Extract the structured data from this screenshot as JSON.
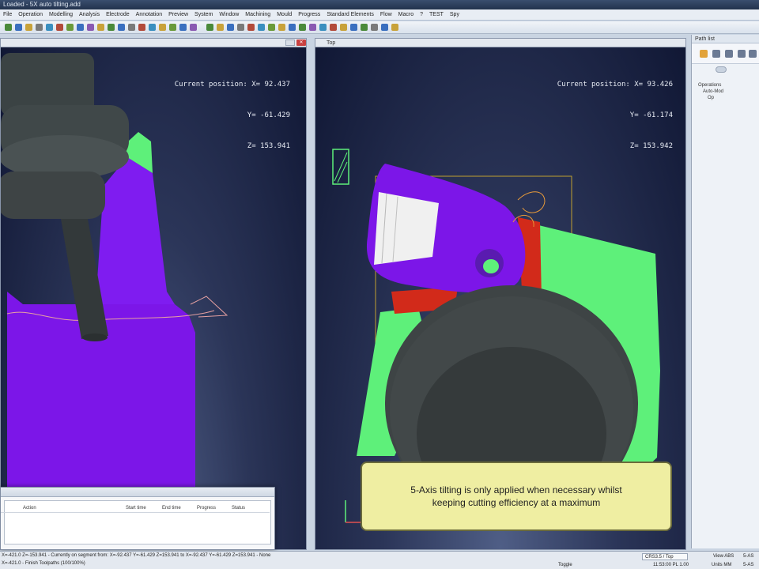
{
  "window": {
    "title": "Loaded - 5X auto tilting.add"
  },
  "menu": {
    "items": [
      "File",
      "Operation",
      "Modelling",
      "Analysis",
      "Electrode",
      "Annotation",
      "Preview",
      "System",
      "Window",
      "Machining",
      "Mould",
      "Progress",
      "Standard Elements",
      "Flow",
      "Macro",
      "?",
      "TEST",
      "Spy"
    ]
  },
  "viewports": {
    "left": {
      "readout": {
        "x_label": "Current position: X=",
        "x": "92.437",
        "y_label": "Y=",
        "y": "-61.429",
        "z_label": "Z=",
        "z": "153.941"
      }
    },
    "right": {
      "title": "Top",
      "readout": {
        "x_label": "Current position: X=",
        "x": "93.426",
        "y_label": "Y=",
        "y": "-61.174",
        "z_label": "Z=",
        "z": "153.942"
      }
    }
  },
  "side_panel": {
    "title": "Path list",
    "tree": [
      "Operations",
      "Auto-Mod",
      "Op"
    ]
  },
  "progress_window": {
    "columns": [
      "Action",
      "Start time",
      "End time",
      "Progress",
      "Status"
    ]
  },
  "caption": {
    "text": "5-Axis tilting is only applied when necessary whilst\nkeeping cutting efficiency at a maximum"
  },
  "status": {
    "line1": "X=-421.0  Z=-153.941  -  Currently on segment from: X=-92.437 Y=-61.429 Z=153.941 to X=-92.437 Y=-61.429 Z=153.941  -  None",
    "line2": "X=-421.0  -  Finish Toolpaths (100/100%)",
    "view_label": "CRS3.5 / Top",
    "view_mode": "View ABS",
    "toggle_label": "Toggle",
    "coord1": "5-AS",
    "units": "Units MM",
    "coord2": "11:53:00 PL 1.00",
    "coord3": "5-AS"
  },
  "colors": {
    "part_purple": "#7c16e8",
    "part_green": "#5ef07a",
    "tool_gray": "#3e4445",
    "holder_red": "#d22a1a",
    "caption_bg": "#efeea2"
  }
}
